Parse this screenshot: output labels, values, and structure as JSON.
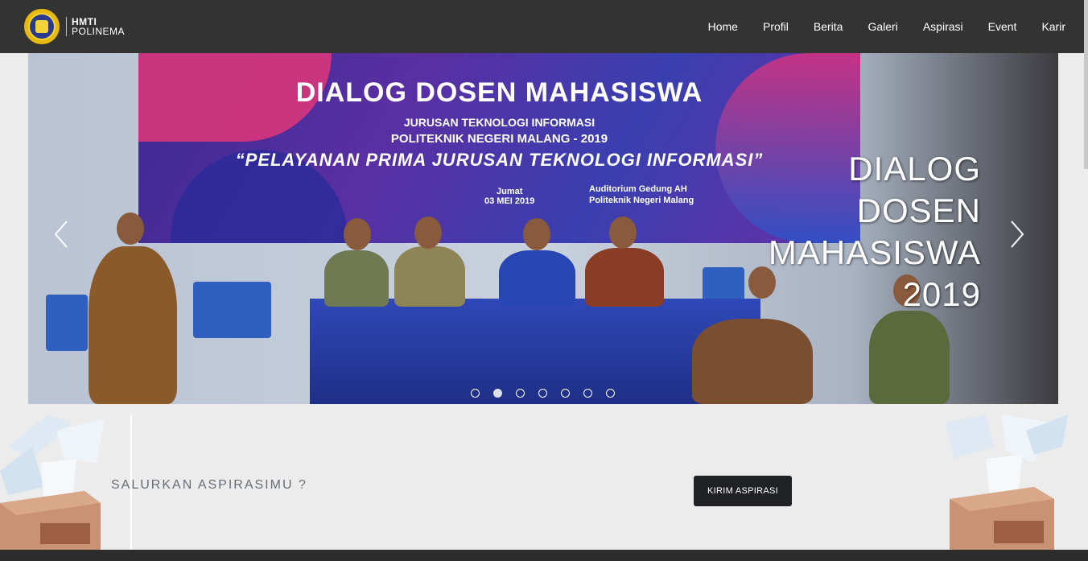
{
  "navbar": {
    "brand_line1": "HMTI",
    "brand_line2": "POLINEMA",
    "items": [
      {
        "label": "Home"
      },
      {
        "label": "Profil"
      },
      {
        "label": "Berita"
      },
      {
        "label": "Galeri"
      },
      {
        "label": "Aspirasi"
      },
      {
        "label": "Event"
      },
      {
        "label": "Karir"
      }
    ],
    "background": "#333333"
  },
  "carousel": {
    "banner": {
      "title": "DIALOG DOSEN MAHASISWA",
      "sub1": "JURUSAN TEKNOLOGI INFORMASI",
      "sub2": "POLITEKNIK NEGERI MALANG - 2019",
      "quote": "“PELAYANAN PRIMA JURUSAN TEKNOLOGI INFORMASI”",
      "date_day": "Jumat",
      "date": "03 MEI 2019",
      "place1": "Auditorium Gedung AH",
      "place2": "Politeknik Negeri Malang"
    },
    "caption_lines": [
      "DIALOG",
      "DOSEN",
      "MAHASISWA",
      "2019"
    ],
    "prev_icon": "chevron-left-icon",
    "next_icon": "chevron-right-icon",
    "slide_count": 7,
    "active_index": 1
  },
  "aspirasi": {
    "text": "SALURKAN ASPIRASIMU ?",
    "button_label": "KIRIM ASPIRASI",
    "button_color": "#1f2124"
  }
}
